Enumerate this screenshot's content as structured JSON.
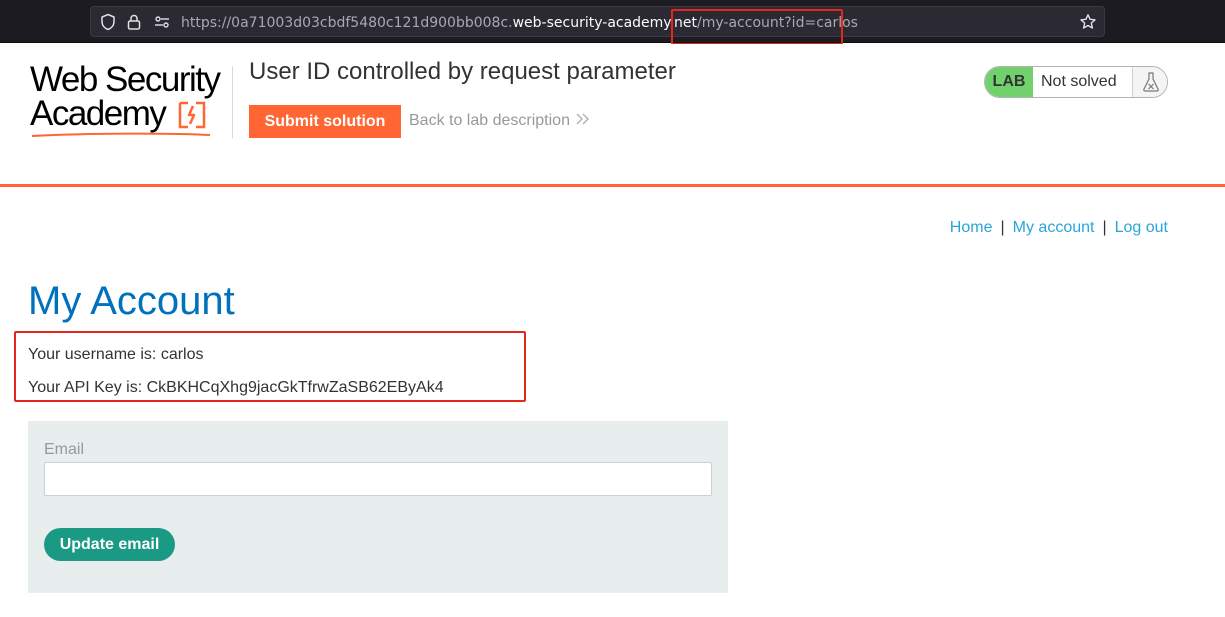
{
  "browser": {
    "url_prefix": "https://0a71003d03cbdf5480c121d900bb008c.",
    "url_host": "web-security-academy.net",
    "url_path": "/my-account?id=carlos",
    "icons": [
      "shield-icon",
      "lock-icon",
      "permissions-icon",
      "bookmark-star-icon"
    ]
  },
  "header": {
    "logo_line1": "Web Security",
    "logo_line2": "Academy",
    "lab_title": "User ID controlled by request parameter",
    "submit_label": "Submit solution",
    "back_label": "Back to lab description",
    "lab_badge": "LAB",
    "lab_state": "Not solved",
    "accent_color": "#ff6633",
    "badge_color": "#70d16d"
  },
  "nav": {
    "home": "Home",
    "my_account": "My account",
    "log_out": "Log out",
    "separator": "|"
  },
  "main": {
    "title": "My Account",
    "username_line": "Your username is: carlos",
    "api_line": "Your API Key is: CkBKHCqXhg9jacGkTfrwZaSB62EByAk4",
    "email_label": "Email",
    "email_value": "",
    "update_label": "Update email",
    "title_color": "#0071bc",
    "button_color": "#1a9a85"
  }
}
